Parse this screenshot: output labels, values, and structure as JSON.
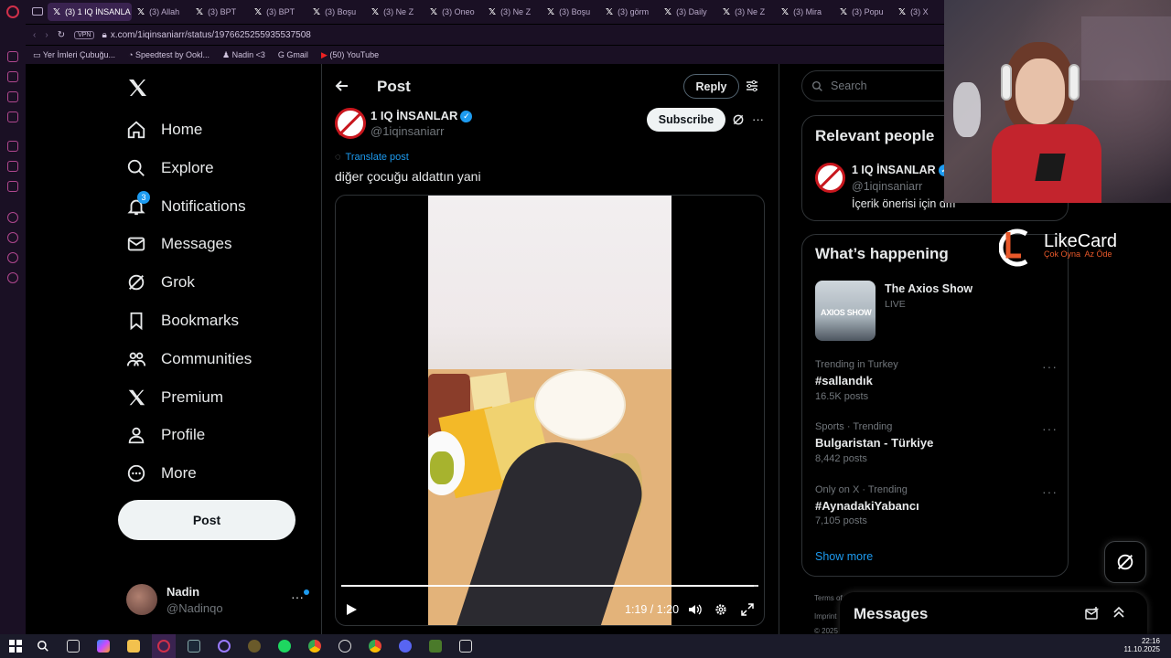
{
  "browser": {
    "tabs": [
      {
        "label": "(3) 1 IQ İNSANLA",
        "active": true
      },
      {
        "label": "(3) Allah"
      },
      {
        "label": "(3) BPT"
      },
      {
        "label": "(3) BPT"
      },
      {
        "label": "(3) Boşu"
      },
      {
        "label": "(3) Ne Z"
      },
      {
        "label": "(3) Oneo"
      },
      {
        "label": "(3) Ne Z"
      },
      {
        "label": "(3) Boşu"
      },
      {
        "label": "(3) görm"
      },
      {
        "label": "(3) Daily"
      },
      {
        "label": "(3) Ne Z"
      },
      {
        "label": "(3) Mira"
      },
      {
        "label": "(3) Popu"
      },
      {
        "label": "(3) X"
      }
    ],
    "vpn_label": "VPN",
    "url": "x.com/1iqinsaniarr/status/1976625255935537508",
    "bookmarks": [
      "Yer İmleri Çubuğu...",
      "Speedtest by Ookl...",
      "Nadin <3",
      "Gmail",
      "(50) YouTube"
    ]
  },
  "nav": {
    "items": [
      {
        "label": "Home"
      },
      {
        "label": "Explore"
      },
      {
        "label": "Notifications",
        "badge": "3"
      },
      {
        "label": "Messages"
      },
      {
        "label": "Grok"
      },
      {
        "label": "Bookmarks"
      },
      {
        "label": "Communities"
      },
      {
        "label": "Premium"
      },
      {
        "label": "Profile"
      },
      {
        "label": "More"
      }
    ],
    "post_label": "Post",
    "account": {
      "name": "Nadin",
      "handle": "@Nadinqo",
      "more": "···"
    }
  },
  "main": {
    "header_title": "Post",
    "reply_label": "Reply",
    "author_name": "1 IQ İNSANLAR",
    "author_handle": "@1iqinsaniarr",
    "subscribe_label": "Subscribe",
    "more": "···",
    "translate_label": "Translate post",
    "tweet_text": "diğer çocuğu aldattın yani",
    "video": {
      "time": "1:19 / 1:20",
      "progress": 0.99
    }
  },
  "right": {
    "search_placeholder": "Search",
    "relevant_title": "Relevant people",
    "relevant_name": "1 IQ İNSANLAR",
    "relevant_handle": "@1iqinsaniarr",
    "relevant_bio": "İçerik önerisi için dm",
    "happening_title": "What’s happening",
    "featured": {
      "title": "The Axios Show",
      "status": "LIVE",
      "thumb_text": "AXIOS SHOW"
    },
    "trends": [
      {
        "meta": "Trending in Turkey",
        "title": "#sallandık",
        "posts": "16.5K posts"
      },
      {
        "meta": "Sports · Trending",
        "title": "Bulgaristan - Türkiye",
        "posts": "8,442 posts"
      },
      {
        "meta": "Only on X · Trending",
        "title": "#AynadakiYabancı",
        "posts": "7,105 posts"
      }
    ],
    "show_more": "Show more",
    "footer": [
      "Terms of",
      "Imprint",
      "© 2025"
    ],
    "messages_title": "Messages"
  },
  "overlay": {
    "brand": "LikeCard",
    "tagline": "Çok Oyna  Az Öde"
  },
  "taskbar": {
    "time": "22:16",
    "date": "11.10.2025"
  },
  "colors": {
    "accent": "#1d9bf0",
    "bg": "#000000",
    "chrome": "#1a1024",
    "brand_orange": "#e8582a"
  }
}
